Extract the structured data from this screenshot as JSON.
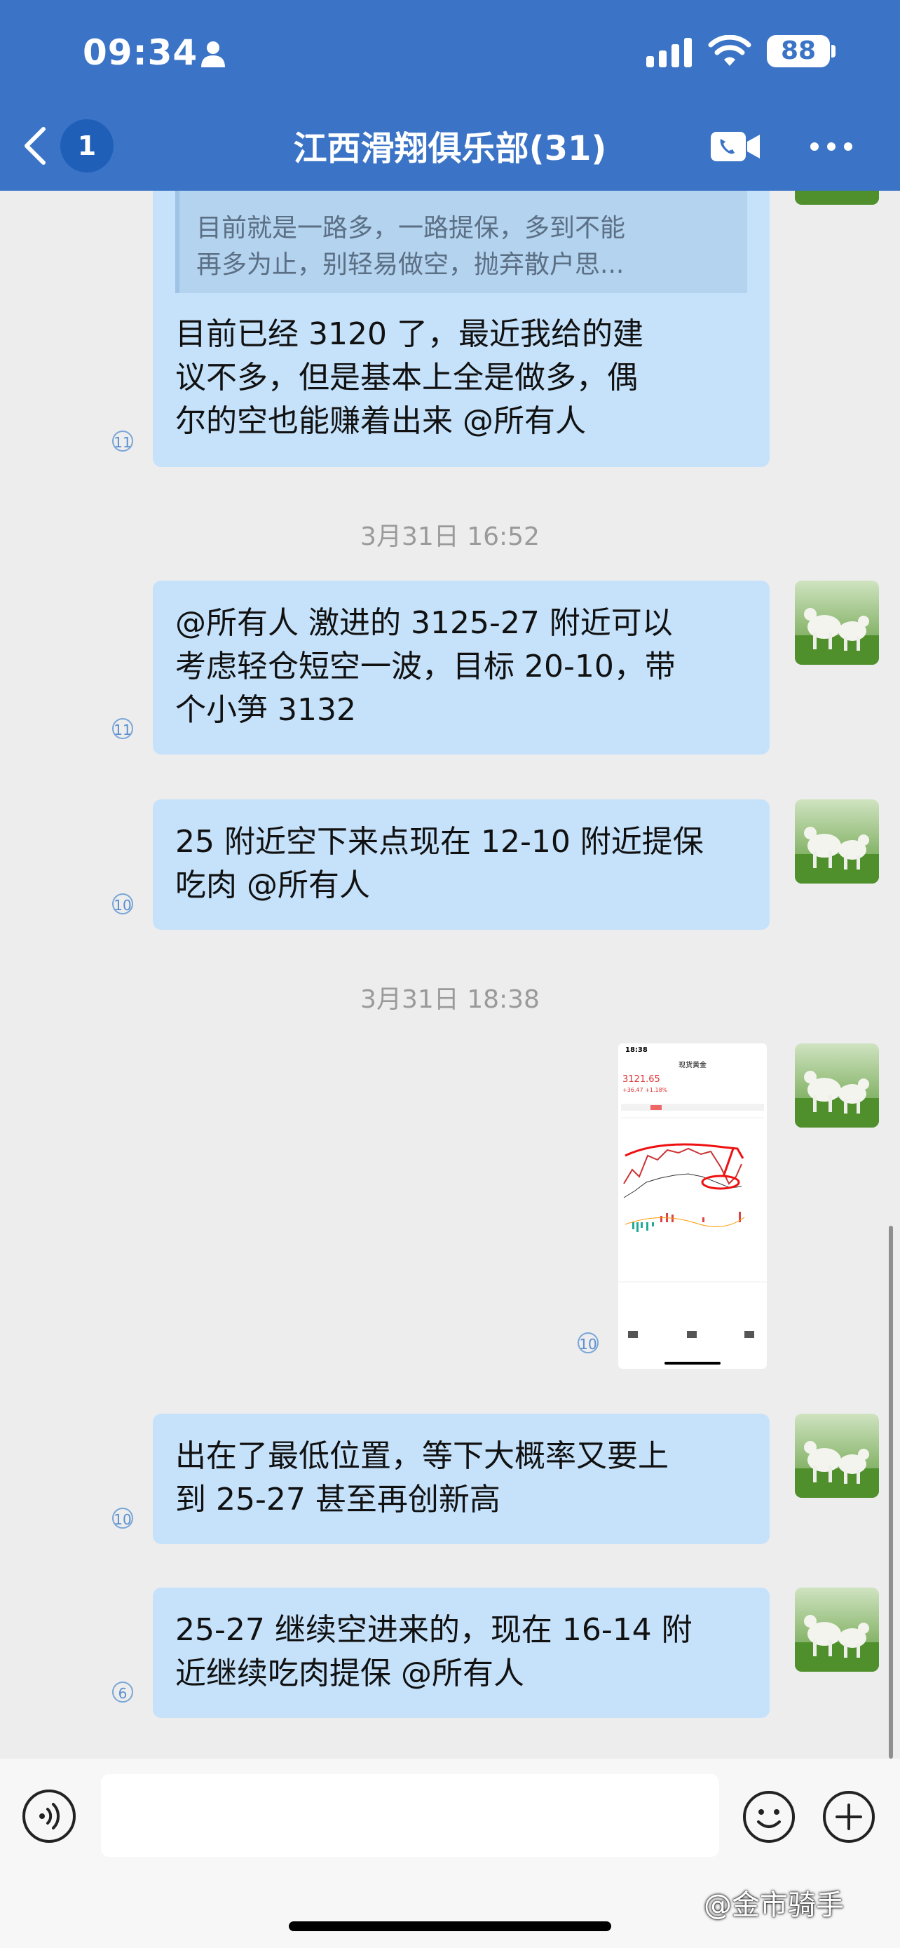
{
  "status_bar": {
    "time": "09:34",
    "battery": "88"
  },
  "header": {
    "back_badge": "1",
    "title": "江西滑翔俱乐部(31)"
  },
  "messages": [
    {
      "quote_lines": [
        "目前就是一路多，一路提保，多到不能",
        "再多为止，别轻易做空，抛弃散户思..."
      ],
      "lines": [
        "目前已经 3120 了，最近我给的建",
        "议不多，但是基本上全是做多，偶",
        "尔的空也能赚着出来 @所有人"
      ],
      "read_count": "11"
    },
    {
      "lines": [
        "@所有人 激进的 3125-27 附近可以",
        "考虑轻仓短空一波，目标 20-10，带",
        "个小笋 3132"
      ],
      "read_count": "11"
    },
    {
      "lines": [
        "25 附近空下来点现在 12-10 附近提保",
        "吃肉 @所有人"
      ],
      "read_count": "10"
    },
    {
      "read_count": "10"
    },
    {
      "lines": [
        "出在了最低位置，等下大概率又要上",
        "到 25-27 甚至再创新高"
      ],
      "read_count": "10"
    },
    {
      "lines": [
        "25-27 继续空进来的，现在 16-14 附",
        "近继续吃肉提保 @所有人"
      ],
      "read_count": "6"
    }
  ],
  "timestamps": [
    "3月31日 16:52",
    "3月31日 18:38"
  ],
  "screenshot": {
    "time": "18:38",
    "title": "现货黄金",
    "price": "3121.65",
    "change": "+36.47 +1.18%"
  },
  "bottom": {
    "watermark": "@金市骑手"
  },
  "colors": {
    "header": "#3b74c6",
    "bubble": "#c6e2fb",
    "background": "#ededed"
  }
}
